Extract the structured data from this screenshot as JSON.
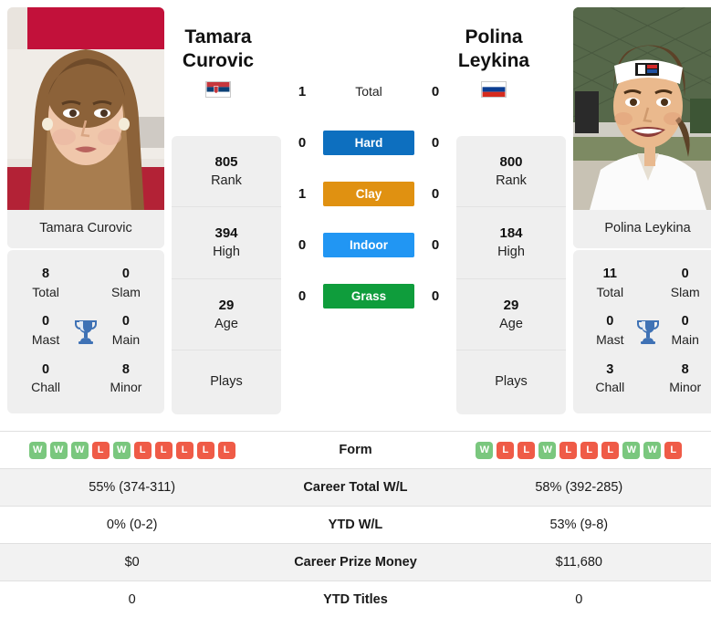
{
  "players": {
    "left": {
      "first_name": "Tamara",
      "last_name": "Curovic",
      "full_name": "Tamara Curovic",
      "country": "Serbia",
      "flag_colors": [
        "#c6363c",
        "#0c4076",
        "#ffffff"
      ],
      "rank": "805",
      "rank_label": "Rank",
      "high": "394",
      "high_label": "High",
      "age": "29",
      "age_label": "Age",
      "plays_label": "Plays",
      "plays_value": "",
      "titles": {
        "total": "8",
        "total_label": "Total",
        "slam": "0",
        "slam_label": "Slam",
        "mast": "0",
        "mast_label": "Mast",
        "main": "0",
        "main_label": "Main",
        "chall": "0",
        "chall_label": "Chall",
        "minor": "8",
        "minor_label": "Minor"
      },
      "form": [
        "W",
        "W",
        "W",
        "L",
        "W",
        "L",
        "L",
        "L",
        "L",
        "L"
      ],
      "career_total_wl": "55% (374-311)",
      "ytd_wl": "0% (0-2)",
      "career_prize_money": "$0",
      "ytd_titles": "0"
    },
    "right": {
      "first_name": "Polina",
      "last_name": "Leykina",
      "full_name": "Polina Leykina",
      "country": "Russia",
      "flag_colors": [
        "#ffffff",
        "#0b3d91",
        "#d52b1e"
      ],
      "rank": "800",
      "rank_label": "Rank",
      "high": "184",
      "high_label": "High",
      "age": "29",
      "age_label": "Age",
      "plays_label": "Plays",
      "plays_value": "",
      "titles": {
        "total": "11",
        "total_label": "Total",
        "slam": "0",
        "slam_label": "Slam",
        "mast": "0",
        "mast_label": "Mast",
        "main": "0",
        "main_label": "Main",
        "chall": "3",
        "chall_label": "Chall",
        "minor": "8",
        "minor_label": "Minor"
      },
      "form": [
        "W",
        "L",
        "L",
        "W",
        "L",
        "L",
        "L",
        "W",
        "W",
        "L"
      ],
      "career_total_wl": "58% (392-285)",
      "ytd_wl": "53% (9-8)",
      "career_prize_money": "$11,680",
      "ytd_titles": "0"
    }
  },
  "head_to_head": {
    "total": {
      "label": "Total",
      "left_score": "1",
      "right_score": "0"
    },
    "surfaces": [
      {
        "label": "Hard",
        "color": "#0d6fbf",
        "left_score": "0",
        "right_score": "0"
      },
      {
        "label": "Clay",
        "color": "#e09111",
        "left_score": "1",
        "right_score": "0"
      },
      {
        "label": "Indoor",
        "color": "#2196f3",
        "left_score": "0",
        "right_score": "0"
      },
      {
        "label": "Grass",
        "color": "#0f9d3c",
        "left_score": "0",
        "right_score": "0"
      }
    ]
  },
  "comparison_rows": [
    {
      "label": "Form",
      "key": "form"
    },
    {
      "label": "Career Total W/L",
      "key": "career_total_wl"
    },
    {
      "label": "YTD W/L",
      "key": "ytd_wl"
    },
    {
      "label": "Career Prize Money",
      "key": "career_prize_money"
    },
    {
      "label": "YTD Titles",
      "key": "ytd_titles"
    }
  ],
  "icons": {
    "trophy": "trophy-icon"
  },
  "colors": {
    "card_background": "#efefef",
    "row_shaded": "#f2f2f2",
    "win_badge": "#7ac77e",
    "loss_badge": "#ef5b47",
    "trophy": "#3f72b5"
  }
}
